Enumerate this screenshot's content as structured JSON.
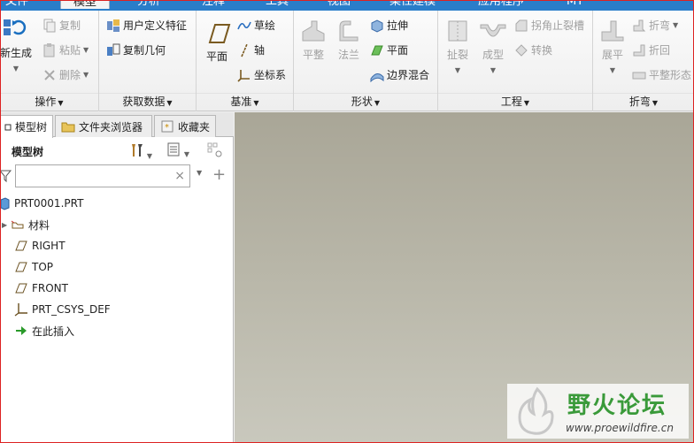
{
  "tabs": [
    "文件",
    "模型",
    "分析",
    "注释",
    "工具",
    "视图",
    "柔性建模",
    "应用程序",
    "MY"
  ],
  "ribbon": {
    "operations": {
      "label": "操作",
      "regenerate": "新生成",
      "copy": "复制",
      "paste": "粘贴",
      "delete": "删除"
    },
    "get_data": {
      "label": "获取数据",
      "udf": "用户定义特征",
      "copy_geom": "复制几何"
    },
    "datum": {
      "label": "基准",
      "plane": "平面",
      "sketch": "草绘",
      "axis": "轴",
      "csys": "坐标系"
    },
    "shapes": {
      "label": "形状",
      "flat": "平整",
      "flange": "法兰",
      "extrude": "拉伸",
      "plane": "平面",
      "blend": "边界混合"
    },
    "engineering": {
      "label": "工程",
      "rip": "扯裂",
      "form": "成型",
      "corner_relief": "拐角止裂槽",
      "convert": "转换"
    },
    "bend": {
      "label": "折弯",
      "unbend": "展平",
      "bend": "折弯",
      "bend_back": "折回",
      "flat_pattern": "平整形态"
    }
  },
  "panel": {
    "tabs": [
      "模型树",
      "文件夹浏览器",
      "收藏夹"
    ],
    "tree_title": "模型树",
    "search_placeholder": "",
    "nodes": [
      {
        "label": "PRT0001.PRT",
        "icon": "part-icon"
      },
      {
        "label": "材料",
        "icon": "material-icon"
      },
      {
        "label": "RIGHT",
        "icon": "datum-plane-icon"
      },
      {
        "label": "TOP",
        "icon": "datum-plane-icon"
      },
      {
        "label": "FRONT",
        "icon": "datum-plane-icon"
      },
      {
        "label": "PRT_CSYS_DEF",
        "icon": "csys-icon"
      },
      {
        "label": "在此插入",
        "icon": "insert-arrow-icon"
      }
    ]
  },
  "watermark": {
    "title": "野火论坛",
    "url": "www.proewildfire.cn"
  },
  "colors": {
    "accent": "#2a7dc9",
    "graphics_bg": "#b5b3a5",
    "watermark_green": "#3a9a3a"
  }
}
